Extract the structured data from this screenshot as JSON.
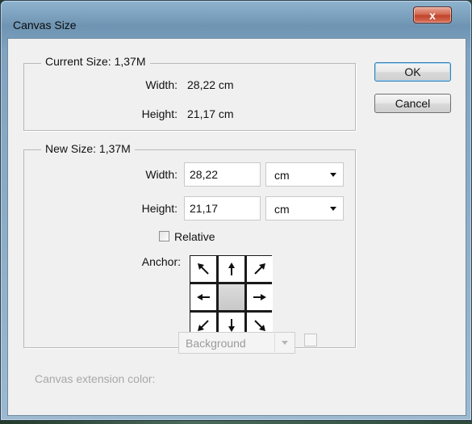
{
  "window": {
    "title": "Canvas Size",
    "close_glyph": "x"
  },
  "current_size": {
    "legend": "Current Size: 1,37M",
    "width_label": "Width:",
    "width_value": "28,22 cm",
    "height_label": "Height:",
    "height_value": "21,17 cm"
  },
  "new_size": {
    "legend": "New Size: 1,37M",
    "width_label": "Width:",
    "width_value": "28,22",
    "width_unit": "cm",
    "height_label": "Height:",
    "height_value": "21,17",
    "height_unit": "cm",
    "relative_label": "Relative",
    "relative_checked": false,
    "anchor_label": "Anchor:",
    "anchor_cells": [
      "arrow-up-left-icon",
      "arrow-up-icon",
      "arrow-up-right-icon",
      "arrow-left-icon",
      "anchor-center",
      "arrow-right-icon",
      "arrow-down-left-icon",
      "arrow-down-icon",
      "arrow-down-right-icon"
    ]
  },
  "extension": {
    "label": "Canvas extension color:",
    "value": "Background"
  },
  "buttons": {
    "ok": "OK",
    "cancel": "Cancel"
  }
}
